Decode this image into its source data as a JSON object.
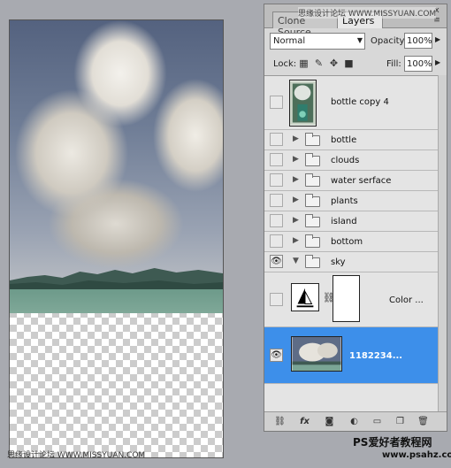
{
  "panel": {
    "tabs": [
      {
        "label": "Clone Source",
        "active": false
      },
      {
        "label": "Layers",
        "active": true
      }
    ],
    "close_glyph": "x",
    "menu_glyph": "≡",
    "blend_mode": "Normal",
    "opacity_label": "Opacity:",
    "opacity_value": "100%",
    "lock_label": "Lock:",
    "lock_icons": [
      "lock-transparent-icon",
      "lock-brush-icon",
      "lock-move-icon",
      "lock-all-icon"
    ],
    "fill_label": "Fill:",
    "fill_value": "100%"
  },
  "layers": [
    {
      "name": "bottle copy 4",
      "type": "pixel",
      "visible": false
    },
    {
      "name": "bottle",
      "type": "group",
      "visible": false,
      "expanded": false
    },
    {
      "name": "clouds",
      "type": "group",
      "visible": false,
      "expanded": false
    },
    {
      "name": "water serface",
      "type": "group",
      "visible": false,
      "expanded": false
    },
    {
      "name": "plants",
      "type": "group",
      "visible": false,
      "expanded": false
    },
    {
      "name": "island",
      "type": "group",
      "visible": false,
      "expanded": false
    },
    {
      "name": "bottom",
      "type": "group",
      "visible": false,
      "expanded": false
    },
    {
      "name": "sky",
      "type": "group",
      "visible": true,
      "expanded": true
    },
    {
      "name": "Color ...",
      "type": "adjustment",
      "visible": false
    },
    {
      "name": "1182234...",
      "type": "pixel",
      "visible": true,
      "selected": true
    }
  ],
  "bottom_icons": [
    "link-icon",
    "fx-icon",
    "mask-icon",
    "adjustment-icon",
    "folder-icon",
    "new-layer-icon",
    "trash-icon"
  ],
  "watermarks": {
    "top": "思缘设计论坛 WWW.MISSYUAN.COM",
    "bottom_left": "思缘设计论坛 WWW.MISSYUAN.COM",
    "brand": "PS爱好者教程网",
    "brand_url": "www.psahz.com"
  },
  "colors": {
    "selection": "#3d8fea",
    "panel_bg": "#d8d8d8"
  }
}
